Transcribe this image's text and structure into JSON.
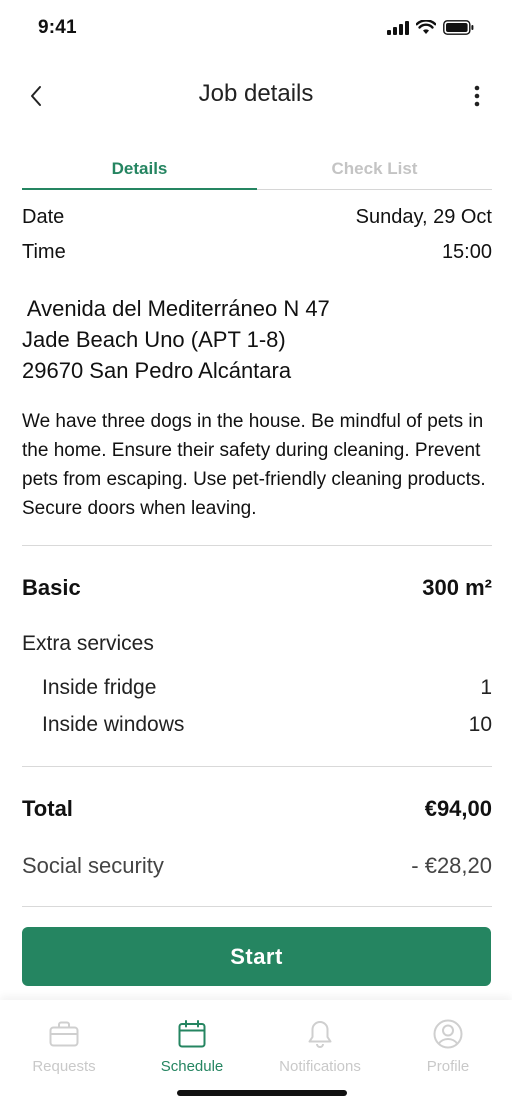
{
  "status_bar": {
    "time": "9:41"
  },
  "nav": {
    "title": "Job details"
  },
  "tabs": [
    {
      "label": "Details",
      "active": true
    },
    {
      "label": "Check List",
      "active": false
    }
  ],
  "job": {
    "date_label": "Date",
    "date_value": "Sunday, 29 Oct",
    "time_label": "Time",
    "time_value": "15:00",
    "address_lines": [
      " Avenida del Mediterráneo N 47",
      "Jade Beach Uno (APT 1-8)",
      "29670 San Pedro Alcántara"
    ],
    "notes": "We have three dogs in the house. Be mindful of pets in the home. Ensure their safety during cleaning. Prevent pets from escaping. Use pet-friendly cleaning products. Secure doors when leaving."
  },
  "service": {
    "name": "Basic",
    "size": "300 m²",
    "extra_title": "Extra services",
    "extras": [
      {
        "name": "Inside fridge",
        "qty": "1"
      },
      {
        "name": "Inside windows",
        "qty": "10"
      }
    ]
  },
  "totals": {
    "total_label": "Total",
    "total_value": "€94,00",
    "ss_label": "Social security",
    "ss_value": "- €28,20"
  },
  "actions": {
    "start_label": "Start"
  },
  "tab_bar": [
    {
      "label": "Requests",
      "icon": "briefcase-icon",
      "active": false
    },
    {
      "label": "Schedule",
      "icon": "calendar-icon",
      "active": true
    },
    {
      "label": "Notifications",
      "icon": "bell-icon",
      "active": false
    },
    {
      "label": "Profile",
      "icon": "profile-icon",
      "active": false
    }
  ],
  "colors": {
    "accent": "#258561",
    "inactive": "#c9c9c9"
  }
}
